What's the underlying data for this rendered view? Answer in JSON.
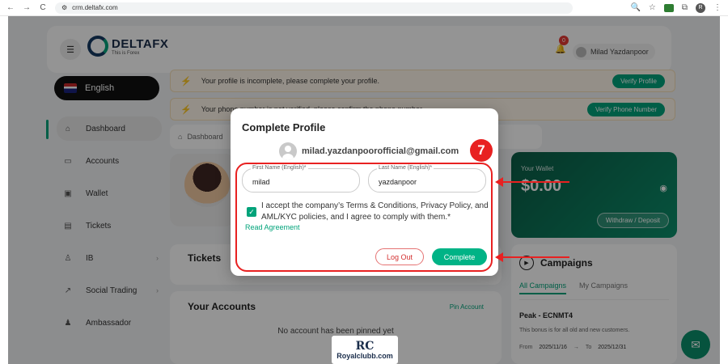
{
  "browser": {
    "url": "crm.deltafx.com",
    "back": "←",
    "forward": "→",
    "reload": "C",
    "profile_initial": "R"
  },
  "header": {
    "brand": "DELTAFX",
    "tagline": "This is Forex",
    "notification_count": "0",
    "user_name": "Milad Yazdanpoor"
  },
  "sidebar": {
    "language": "English",
    "items": [
      {
        "label": "Dashboard",
        "icon": "home-icon"
      },
      {
        "label": "Accounts",
        "icon": "accounts-icon"
      },
      {
        "label": "Wallet",
        "icon": "wallet-icon"
      },
      {
        "label": "Tickets",
        "icon": "ticket-icon"
      },
      {
        "label": "IB",
        "icon": "ib-icon"
      },
      {
        "label": "Social Trading",
        "icon": "trend-icon"
      },
      {
        "label": "Ambassador",
        "icon": "people-icon"
      }
    ]
  },
  "alerts": {
    "profile_text": "Your profile is incomplete, please complete your profile.",
    "profile_button": "Verify Profile",
    "phone_text": "Your phone number is not verified, please confirm the phone number.",
    "phone_button": "Verify Phone Number"
  },
  "breadcrumb": {
    "label": "Dashboard"
  },
  "wallet": {
    "label": "Your Wallet",
    "amount": "$0.00",
    "button": "Withdraw / Deposit"
  },
  "tickets": {
    "title": "Tickets"
  },
  "campaigns": {
    "title": "Campaigns",
    "tab_all": "All Campaigns",
    "tab_mine": "My Campaigns",
    "item_name": "Peak - ECNMT4",
    "item_desc": "This bonus is for all old and new customers.",
    "from_label": "From",
    "from_date": "2025/11/16",
    "to_label": "To",
    "to_date": "2025/12/31"
  },
  "accounts": {
    "title": "Your Accounts",
    "pin_link": "Pin Account",
    "empty_text": "No account has been pinned yet"
  },
  "modal": {
    "title": "Complete Profile",
    "email": "milad.yazdanpoorofficial@gmail.com",
    "step_number": "7",
    "first_name_label": "First Name (English)*",
    "first_name_value": "milad",
    "last_name_label": "Last Name (English)*",
    "last_name_value": "yazdanpoor",
    "terms_text": "I accept the company’s Terms & Conditions, Privacy Policy, and AML/KYC policies, and I agree to comply with them.*",
    "terms_checked": true,
    "read_agreement": "Read Agreement",
    "logout_button": "Log Out",
    "complete_button": "Complete"
  },
  "watermark": {
    "logo": "RC",
    "text": "Royalclubb.com"
  },
  "colors": {
    "accent": "#00a37a",
    "annotation": "#e82121",
    "brand_dark": "#1a2d4b"
  }
}
